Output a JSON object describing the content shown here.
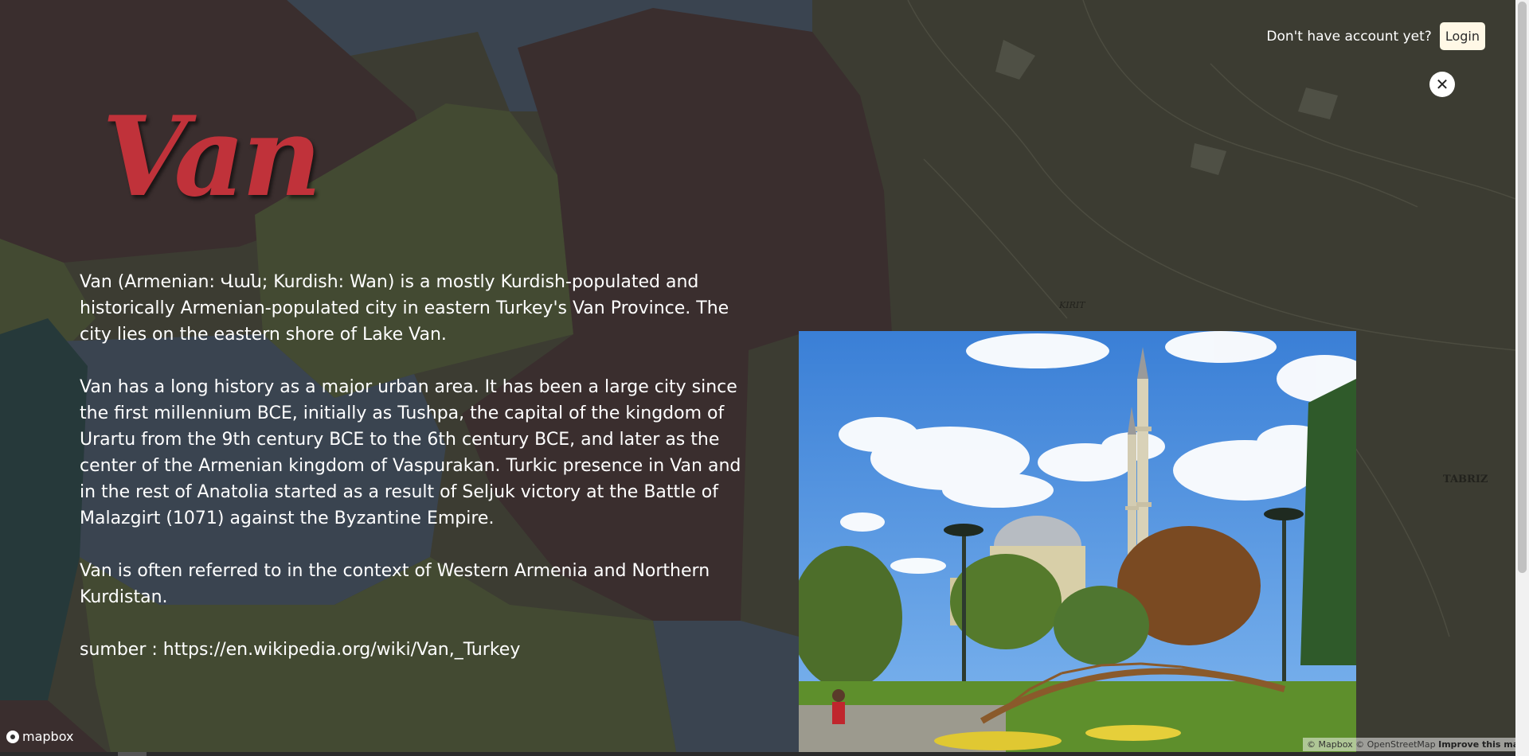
{
  "header": {
    "prompt": "Don't have account yet?",
    "login_label": "Login",
    "close_label": "✕"
  },
  "city": {
    "title": "Van",
    "paragraphs": [
      "Van (Armenian: Վան; Kurdish: Wan) is a mostly Kurdish-populated and historically Armenian-populated city in eastern Turkey's Van Province. The city lies on the eastern shore of Lake Van.",
      "Van has a long history as a major urban area. It has been a large city since the first millennium BCE, initially as Tushpa, the capital of the kingdom of Urartu from the 9th century BCE to the 6th century BCE, and later as the center of the Armenian kingdom of Vaspurakan. Turkic presence in Van and in the rest of Anatolia started as a result of Seljuk victory at the Battle of Malazgirt (1071) against the Byzantine Empire.",
      "Van is often referred to in the context of Western Armenia and Northern Kurdistan."
    ],
    "source": "sumber : https://en.wikipedia.org/wiki/Van,_Turkey"
  },
  "map": {
    "labels": [
      "KIRIT",
      "TABRIZ"
    ],
    "logo": "mapbox",
    "attribution": {
      "mapbox": "© Mapbox",
      "osm": "© OpenStreetMap",
      "improve": "Improve this map"
    }
  },
  "colors": {
    "title_red": "#c0323a",
    "region_dark": "#3a2e2e",
    "region_olive": "#434a32",
    "region_slate": "#3a4450",
    "region_teal": "#26393a",
    "basemap": "#3c3c32"
  }
}
